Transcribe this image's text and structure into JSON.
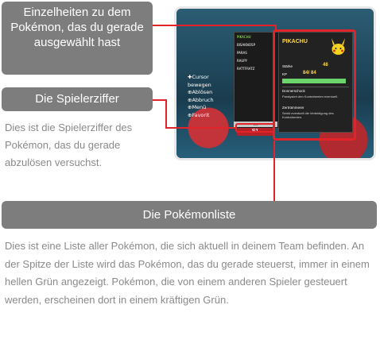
{
  "annotations": {
    "selected_pokemon_label": "Einzelheiten zu dem Pokémon, das du gerade ausgewählt hast",
    "player_number_label": "Die Spielerziffer",
    "player_number_desc": "Dies ist die Spielerziffer des Pokémon, das du gerade abzulösen versuchst.",
    "pokemon_list_label": "Die Pokémonliste",
    "pokemon_list_desc": "Dies ist eine Liste aller Pokémon, die sich aktuell in deinem Team befinden. An der Spitze der Liste wird das Pokémon, das du gerade steuerst, immer in einem hellen Grün angezeigt. Pokémon, die von einem anderen Spieler gesteuert werden, erscheinen dort in einem kräftigen Grün."
  },
  "screen": {
    "list": [
      "PIKACHU",
      "BISAKNOSP",
      "PARAS",
      "RAUPY",
      "RATTFRATZ"
    ],
    "counter": "1/1",
    "player_tag": "S1",
    "controls": [
      "✚Cursor",
      "bewegen",
      "⊕Ablösen",
      "⊕Abbruch",
      "⊕Menü",
      "⊕Favorit"
    ],
    "detail": {
      "name": "PIKACHU",
      "stat1_label": "Stärke",
      "stat1_value": "48",
      "hp_label": "KP",
      "hp_value": "84/ 84",
      "move1": "Donnerschock",
      "move1_desc": "Paralysiert den Kontrahenten eventuell.",
      "move2": "Zertrümmerer",
      "move2_desc": "Senkt eventuell die Verteidigung des Kontrahenten."
    },
    "hp_fraction": 1.0
  },
  "colors": {
    "accent_red": "#e0242a",
    "label_gray": "#7d7d7d",
    "text_gray": "#8a8a8a",
    "active_green": "#a6ff6a"
  }
}
